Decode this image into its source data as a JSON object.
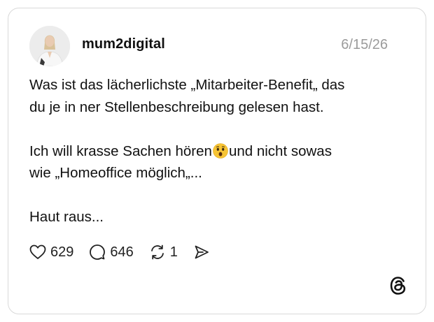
{
  "post": {
    "username": "mum2digital",
    "date": "6/15/26",
    "lines": {
      "p1_l1": "Was ist das lächerlichste „Mitarbeiter-Benefit„ das",
      "p1_l2": "du je in ner Stellenbeschreibung gelesen hast.",
      "p2_l1_a": "Ich will krasse Sachen hören",
      "p2_l1_b": "und nicht sowas",
      "p2_l2": "wie „Homeoffice möglich„...",
      "p3_l1": "Haut raus..."
    }
  },
  "actions": {
    "likes": "629",
    "replies": "646",
    "reposts": "1"
  },
  "icons": {
    "like": "heart-icon",
    "reply": "speech-bubble-icon",
    "repost": "repost-icon",
    "share": "send-icon",
    "emoji": "astonished-face-emoji",
    "logo": "threads-logo-icon"
  },
  "colors": {
    "text": "#111111",
    "muted": "#9b9b9b",
    "border": "#d9d9d9"
  }
}
